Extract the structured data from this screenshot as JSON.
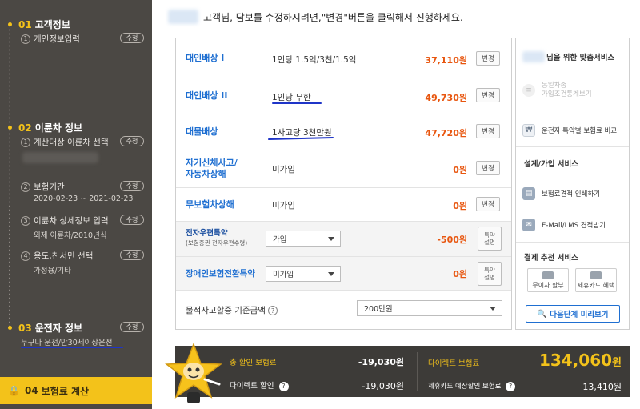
{
  "sidebar": {
    "sections": [
      {
        "num": "01",
        "title": "고객정보"
      },
      {
        "num": "02",
        "title": "이륜차 정보"
      },
      {
        "num": "03",
        "title": "운전자 정보"
      },
      {
        "num": "04",
        "title": "보험료 계산"
      }
    ],
    "edit_label": "수정",
    "steps": {
      "personal": {
        "num": "1",
        "label": "개인정보입력"
      },
      "vehicle_select": {
        "num": "1",
        "label": "계산대상 이륜차 선택"
      },
      "period": {
        "num": "2",
        "label": "보험기간",
        "sub": "2020-02-23 ~ 2021-02-23"
      },
      "detail": {
        "num": "3",
        "label": "이륜차 상세정보 입력",
        "sub": "외제 이륜차/2010년식"
      },
      "usage": {
        "num": "4",
        "label": "용도,친서민 선택",
        "sub": "가정용/기타"
      }
    },
    "driver_sub": "누구나 운전/만30세이상운전"
  },
  "header": {
    "text": "고객님, 담보를 수정하시려면,\"변경\"버튼을 클릭해서 진행하세요."
  },
  "coverages": [
    {
      "label": "대인배상 I",
      "desc": "1인당 1.5억/3천/1.5억",
      "price": "37,110원",
      "button": "변경"
    },
    {
      "label": "대인배상 II",
      "desc": "1인당 무한",
      "price": "49,730원",
      "button": "변경"
    },
    {
      "label": "대물배상",
      "desc": "1사고당 3천만원",
      "price": "47,720원",
      "button": "변경"
    },
    {
      "label": "자기신체사고/\n자동차상해",
      "desc": "미가입",
      "price": "0원",
      "button": "변경"
    },
    {
      "label": "무보험차상해",
      "desc": "미가입",
      "price": "0원",
      "button": "변경"
    }
  ],
  "special": [
    {
      "label": "전자우편특약",
      "sublabel": "(보험증권 전자우편수령)",
      "select": "가입",
      "price": "-500원",
      "button": "특약\n설명"
    },
    {
      "label": "장애인보험전환특약",
      "select": "미가입",
      "price": "0원",
      "button": "특약\n설명"
    }
  ],
  "damage_base": {
    "label": "물적사고할증 기준금액",
    "help": "?",
    "select": "200만원"
  },
  "right_panel": {
    "title_suffix": "님을 위한 맞춤서비스",
    "items": [
      {
        "icon": "compare-car-icon",
        "label": "동일차종\n가입조건통계보기"
      },
      {
        "icon": "discount-compare-icon",
        "label": "운전자 특약별 보험료 비교"
      }
    ],
    "design_heading": "설계/가입 서비스",
    "design_items": [
      {
        "icon": "print-icon",
        "label": "보험료견적 인쇄하기"
      },
      {
        "icon": "mail-icon",
        "label": "E-Mail/LMS 견적받기"
      }
    ],
    "payment_heading": "결제 추천 서비스",
    "payment_buttons": [
      "무이자 할부",
      "제휴카드 혜택"
    ],
    "next_label": "다음단계 미리보기"
  },
  "summary": {
    "total_discount_label": "총 할인 보험료",
    "total_discount_value": "-19,030원",
    "direct_discount_label": "다이렉트 할인",
    "direct_discount_value": "-19,030원",
    "direct_premium_label": "다이렉트 보험료",
    "direct_premium_value": "134,060",
    "direct_premium_unit": "원",
    "card_discount_label": "제휴카드 예상할인 보험료",
    "card_discount_value": "13,410원"
  },
  "colors": {
    "accent": "#f3c21a",
    "link_blue": "#1f6fd1",
    "price_orange": "#e8560f",
    "sidebar_bg": "#4b4844"
  }
}
